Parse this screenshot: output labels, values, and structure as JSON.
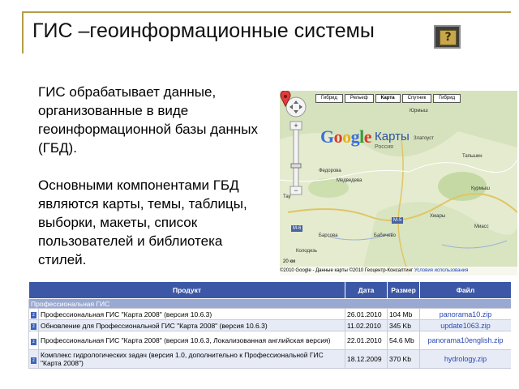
{
  "slide": {
    "title": "ГИС –геоинформационные системы",
    "help_glyph": "?",
    "paragraph1": "ГИС обрабатывает данные, организованные в виде геоинформационной базы данных (ГБД).",
    "paragraph2": "Основными компонентами ГБД являются карты, темы, таблицы, выборки, макеты, список пользователей и библиотека стилей."
  },
  "map": {
    "tabs": [
      "Гибрид",
      "Рельеф",
      "Карта",
      "Спутник",
      "Гибрид"
    ],
    "logo_letters": [
      "G",
      "o",
      "o",
      "g",
      "l",
      "e"
    ],
    "logo_colors": [
      "#3b6fd8",
      "#d93b2b",
      "#e3b219",
      "#3b6fd8",
      "#3b9a3b",
      "#d93b2b"
    ],
    "service_name": "Карты",
    "region": "Россия",
    "cities": [
      "Юрмыш",
      "Златоуст",
      "Тапьшин",
      "Федорова",
      "Медведева",
      "Тау",
      "Курмыш",
      "Хмары",
      "Бабичево",
      "Миасс",
      "Барсова",
      "Колодезь"
    ],
    "highway": "М-5",
    "highway2": "М-6",
    "scale_text": "20 км",
    "footer_copyright": "©2010 Google - Данные карты ©2010 Геоцентр-Консалтинг",
    "footer_terms": "Условия использования"
  },
  "table": {
    "headers": [
      "Продукт",
      "Дата",
      "Размер",
      "Файл"
    ],
    "section": "Профессиональная ГИС",
    "rows": [
      {
        "product": "Профессиональная ГИС \"Карта 2008\" (версия 10.6.3)",
        "date": "26.01.2010",
        "size": "104 Mb",
        "file": "panorama10.zip"
      },
      {
        "product": "Обновление для Профессиональной ГИС \"Карта 2008\" (версия 10.6.3)",
        "date": "11.02.2010",
        "size": "345 Kb",
        "file": "update1063.zip"
      },
      {
        "product": "Профессиональная ГИС \"Карта 2008\" (версия 10.6.3, Локализованная английская версия)",
        "date": "22.01.2010",
        "size": "54.6 Mb",
        "file": "panorama10english.zip"
      },
      {
        "product": "Комплекс гидрологических задач (версия 1.0, дополнительно к Профессиональной ГИС \"Карта 2008\")",
        "date": "18.12.2009",
        "size": "370 Kb",
        "file": "hydrology.zip"
      }
    ]
  }
}
